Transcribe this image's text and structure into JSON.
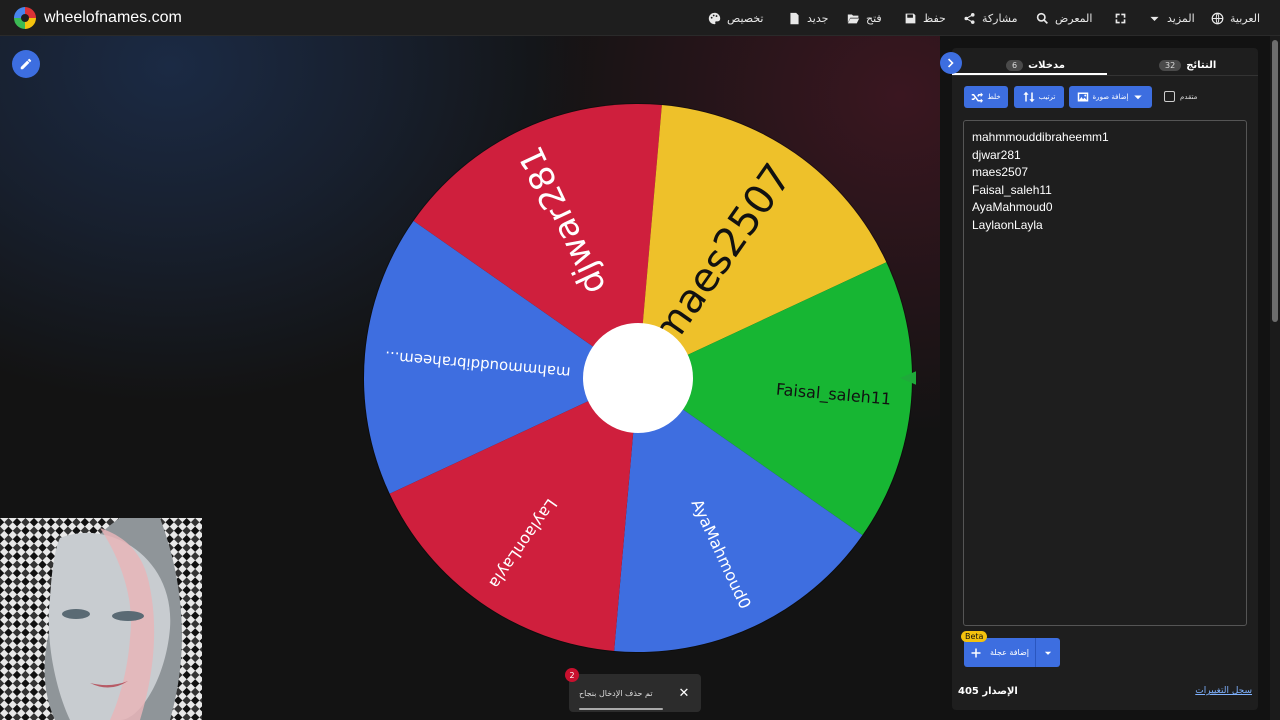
{
  "header": {
    "brand": "wheelofnames.com",
    "nav": {
      "language": "العربية",
      "more": "المزيد",
      "fullscreen_icon": "fullscreen-icon",
      "gallery": "المعرض",
      "share": "مشاركة",
      "save": "حفظ",
      "open": "فتح",
      "new": "جديد",
      "customize": "تخصيص"
    }
  },
  "wheel": {
    "segments": [
      {
        "label": "mahmmouddibraheem...",
        "color": "#3e6ee0"
      },
      {
        "label": "djwar281",
        "color": "#cf1f3d"
      },
      {
        "label": "maes2507",
        "color": "#eec12a"
      },
      {
        "label": "Faisal_saleh11",
        "color": "#17b633"
      },
      {
        "label": "AyaMahmoud0",
        "color": "#3e6ee0"
      },
      {
        "label": "LaylaonLayla",
        "color": "#cf1f3d"
      }
    ],
    "pointer_color": "#1faa3a"
  },
  "panel": {
    "tabs": {
      "entries_label": "مدخلات",
      "entries_count": "6",
      "results_label": "النتائج",
      "results_count": "32"
    },
    "tools": {
      "shuffle": "خلط",
      "sort": "ترتيب",
      "add_image": "إضافة صورة",
      "advanced": "متقدم"
    },
    "entries": [
      "mahmmouddibraheemm1",
      "djwar281",
      "maes2507",
      "Faisal_saleh11",
      "AyaMahmoud0",
      "LaylaonLayla"
    ],
    "add_wheel": "إضافة عجلة",
    "beta": "Beta",
    "version": "الإصدار 405",
    "changelog": "سجل التغييرات"
  },
  "toast": {
    "message": "تم حذف الإدخال بنجاح",
    "count": "2",
    "close": "✕"
  },
  "colors": {
    "accent": "#3d6ee0",
    "panel_bg": "#1e1e1e",
    "beta": "#f4c20d"
  }
}
